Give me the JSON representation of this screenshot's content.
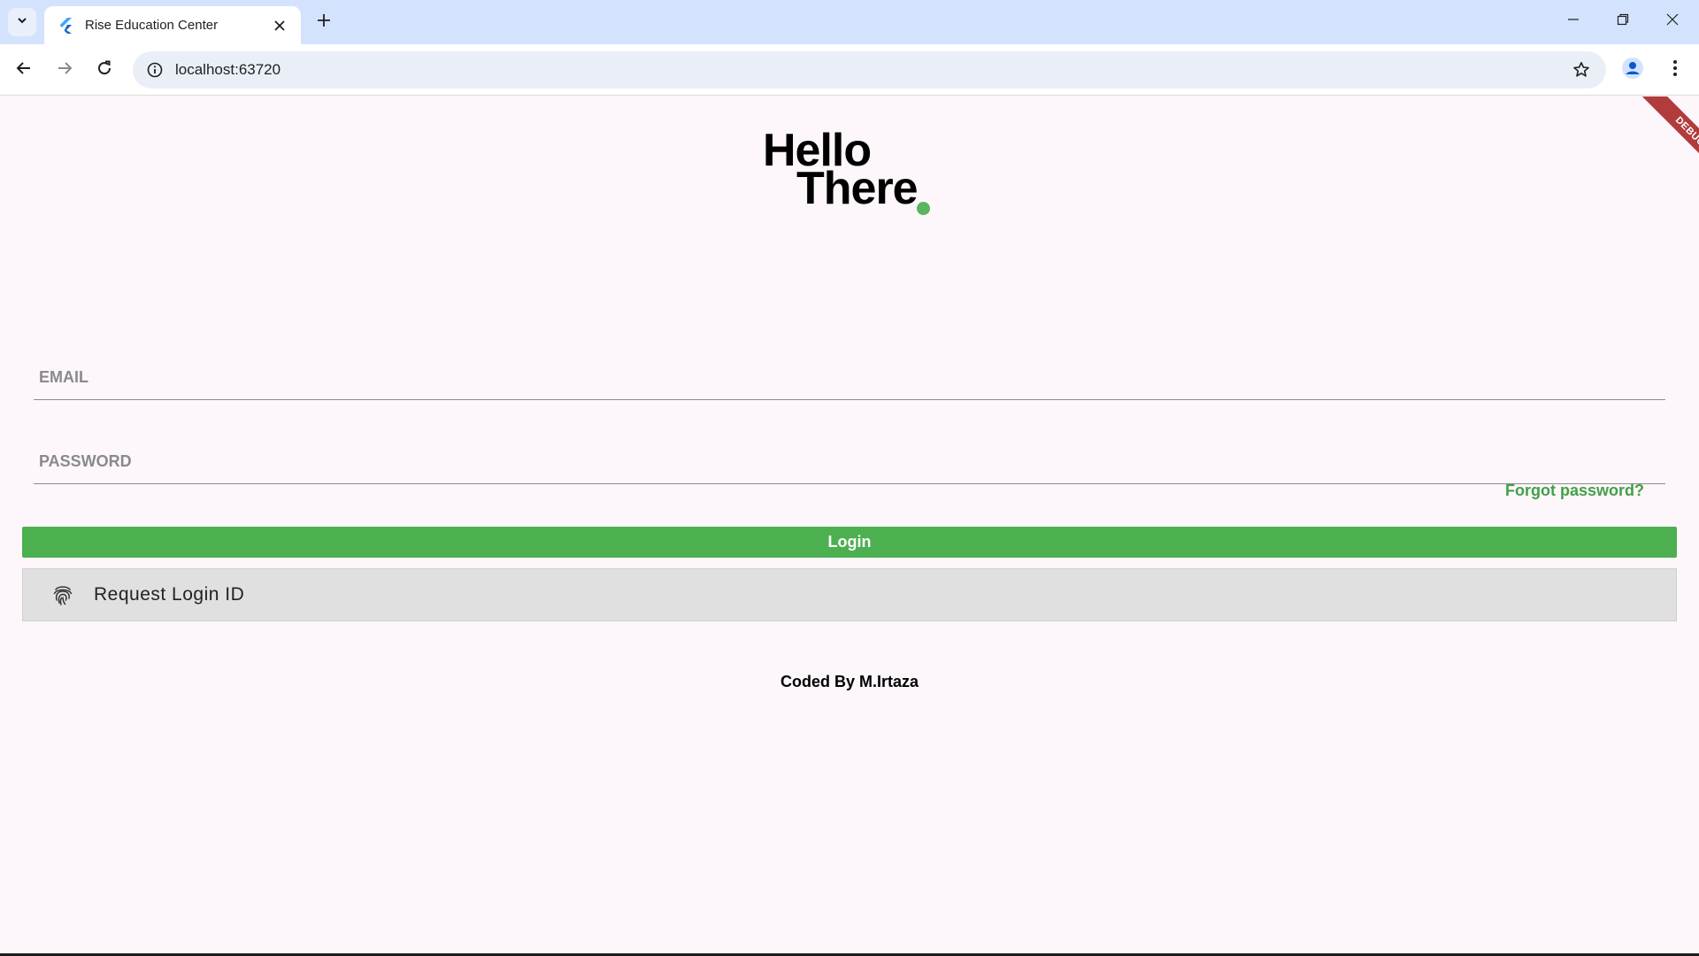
{
  "browser": {
    "tab_title": "Rise Education Center",
    "url": "localhost:63720"
  },
  "page": {
    "debug_label": "DEBUG",
    "greeting_line1": "Hello",
    "greeting_line2": "There",
    "email_placeholder": "EMAIL",
    "email_value": "",
    "password_placeholder": "PASSWORD",
    "password_value": "",
    "forgot_password": "Forgot password?",
    "login_button": "Login",
    "request_login_button": "Request Login ID",
    "credit": "Coded By M.Irtaza"
  },
  "colors": {
    "accent_green": "#4caf50",
    "debug_red": "#b23b3b",
    "tabstrip_blue": "#d3e3fd"
  },
  "icons": {
    "tab_search": "chevron-down-icon",
    "favicon": "flutter-icon",
    "tab_close": "close-icon",
    "new_tab": "plus-icon",
    "back": "arrow-left-icon",
    "forward": "arrow-right-icon",
    "reload": "reload-icon",
    "site_info": "info-icon",
    "bookmark": "star-icon",
    "profile": "person-icon",
    "menu": "kebab-menu-icon",
    "fingerprint": "fingerprint-icon"
  }
}
